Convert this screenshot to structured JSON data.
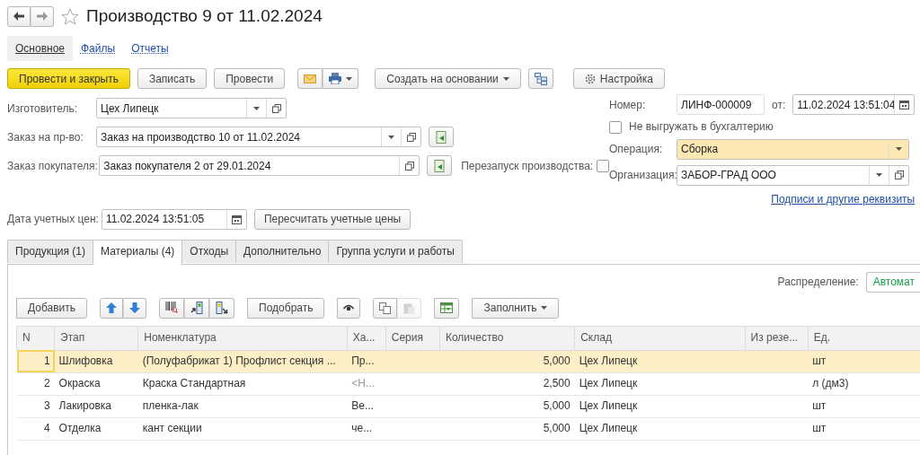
{
  "window": {
    "title": "Производство 9 от 11.02.2024",
    "favorite": false
  },
  "sections": [
    {
      "label": "Основное",
      "selected": true
    },
    {
      "label": "Файлы",
      "selected": false
    },
    {
      "label": "Отчеты",
      "selected": false
    }
  ],
  "toolbar": [
    {
      "kind": "primary",
      "label": "Провести и закрыть"
    },
    {
      "kind": "text",
      "label": "Записать"
    },
    {
      "kind": "text",
      "label": "Провести"
    },
    {
      "kind": "mail"
    },
    {
      "kind": "print"
    },
    {
      "kind": "dropdown",
      "label": "Создать на основании"
    },
    {
      "kind": "structure"
    },
    {
      "kind": "settings",
      "label": "Настройка"
    }
  ],
  "left_fields": [
    {
      "label": "Изготовитель:",
      "value": "Цех Липецк",
      "dropdown": true,
      "fill_button": false
    },
    {
      "label": "Заказ на пр-во:",
      "value": "Заказ на производство 10 от 11.02.2024",
      "dropdown": true,
      "fill_button": true
    },
    {
      "label": "Заказ покупателя:",
      "value": "Заказ покупателя 2 от 29.01.2024",
      "dropdown": false,
      "fill_button": true
    }
  ],
  "restart": {
    "label": "Перезапуск производства:",
    "checked": false
  },
  "number": {
    "label": "Номер:",
    "value": "ЛИНФ-000009"
  },
  "date": {
    "label": "от:",
    "value": "11.02.2024 13:51:04"
  },
  "no_export": {
    "label": "Не выгружать в бухгалтерию",
    "checked": false
  },
  "operation": {
    "label": "Операция:",
    "value": "Сборка",
    "highlighted": true
  },
  "organization": {
    "label": "Организация:",
    "value": "ЗАБОР-ГРАД ООО"
  },
  "details_link": "Подписи и другие реквизиты",
  "price_date": {
    "label": "Дата учетных цен:",
    "value": "11.02.2024 13:51:05"
  },
  "recalc_button": "Пересчитать учетные цены",
  "tabs": [
    {
      "label": "Продукция (1)",
      "selected": false
    },
    {
      "label": "Материалы (4)",
      "selected": true
    },
    {
      "label": "Отходы",
      "selected": false
    },
    {
      "label": "Дополнительно",
      "selected": false
    },
    {
      "label": "Группа услуги и работы",
      "selected": false
    }
  ],
  "distribution": {
    "label": "Распределение:",
    "value": "Автомат"
  },
  "table_toolbar": [
    [
      {
        "kind": "text",
        "label": "Добавить",
        "disabled": false
      }
    ],
    [
      {
        "kind": "up",
        "disabled": false
      },
      {
        "kind": "down",
        "disabled": false
      }
    ],
    [
      {
        "kind": "barcode",
        "disabled": false
      },
      {
        "kind": "scanner-in",
        "disabled": false
      },
      {
        "kind": "scanner-out",
        "disabled": false
      }
    ],
    [
      {
        "kind": "text",
        "label": "Подобрать",
        "disabled": false
      }
    ],
    [
      {
        "kind": "eye",
        "disabled": false
      }
    ],
    [
      {
        "kind": "copy",
        "disabled": false
      },
      {
        "kind": "paste",
        "disabled": true
      }
    ],
    [
      {
        "kind": "fill-table",
        "disabled": false
      }
    ],
    [
      {
        "kind": "dropdown",
        "label": "Заполнить",
        "disabled": false
      }
    ]
  ],
  "table": {
    "columns": [
      "N",
      "Этап",
      "Номенклатура",
      "Ха...",
      "Серия",
      "Количество",
      "Склад",
      "Из резе...",
      "Ед."
    ],
    "rows": [
      {
        "selected": true,
        "cells": [
          "1",
          "Шлифовка",
          "(Полуфабрикат 1) Профлист секция ...",
          "Пр...",
          "",
          "5,000",
          "Цех Липецк",
          "",
          "шт"
        ]
      },
      {
        "selected": false,
        "cells": [
          "2",
          "Окраска",
          "Краска Стандартная",
          "<Н...",
          "",
          "2,500",
          "Цех Липецк",
          "",
          "л (дм3)"
        ]
      },
      {
        "selected": false,
        "cells": [
          "3",
          "Лакировка",
          "пленка-лак",
          "Ве...",
          "",
          "5,000",
          "Цех Липецк",
          "",
          "шт"
        ]
      },
      {
        "selected": false,
        "cells": [
          "4",
          "Отделка",
          "кант секции",
          "че...",
          "",
          "5,000",
          "Цех Липецк",
          "",
          "шт"
        ]
      }
    ]
  }
}
